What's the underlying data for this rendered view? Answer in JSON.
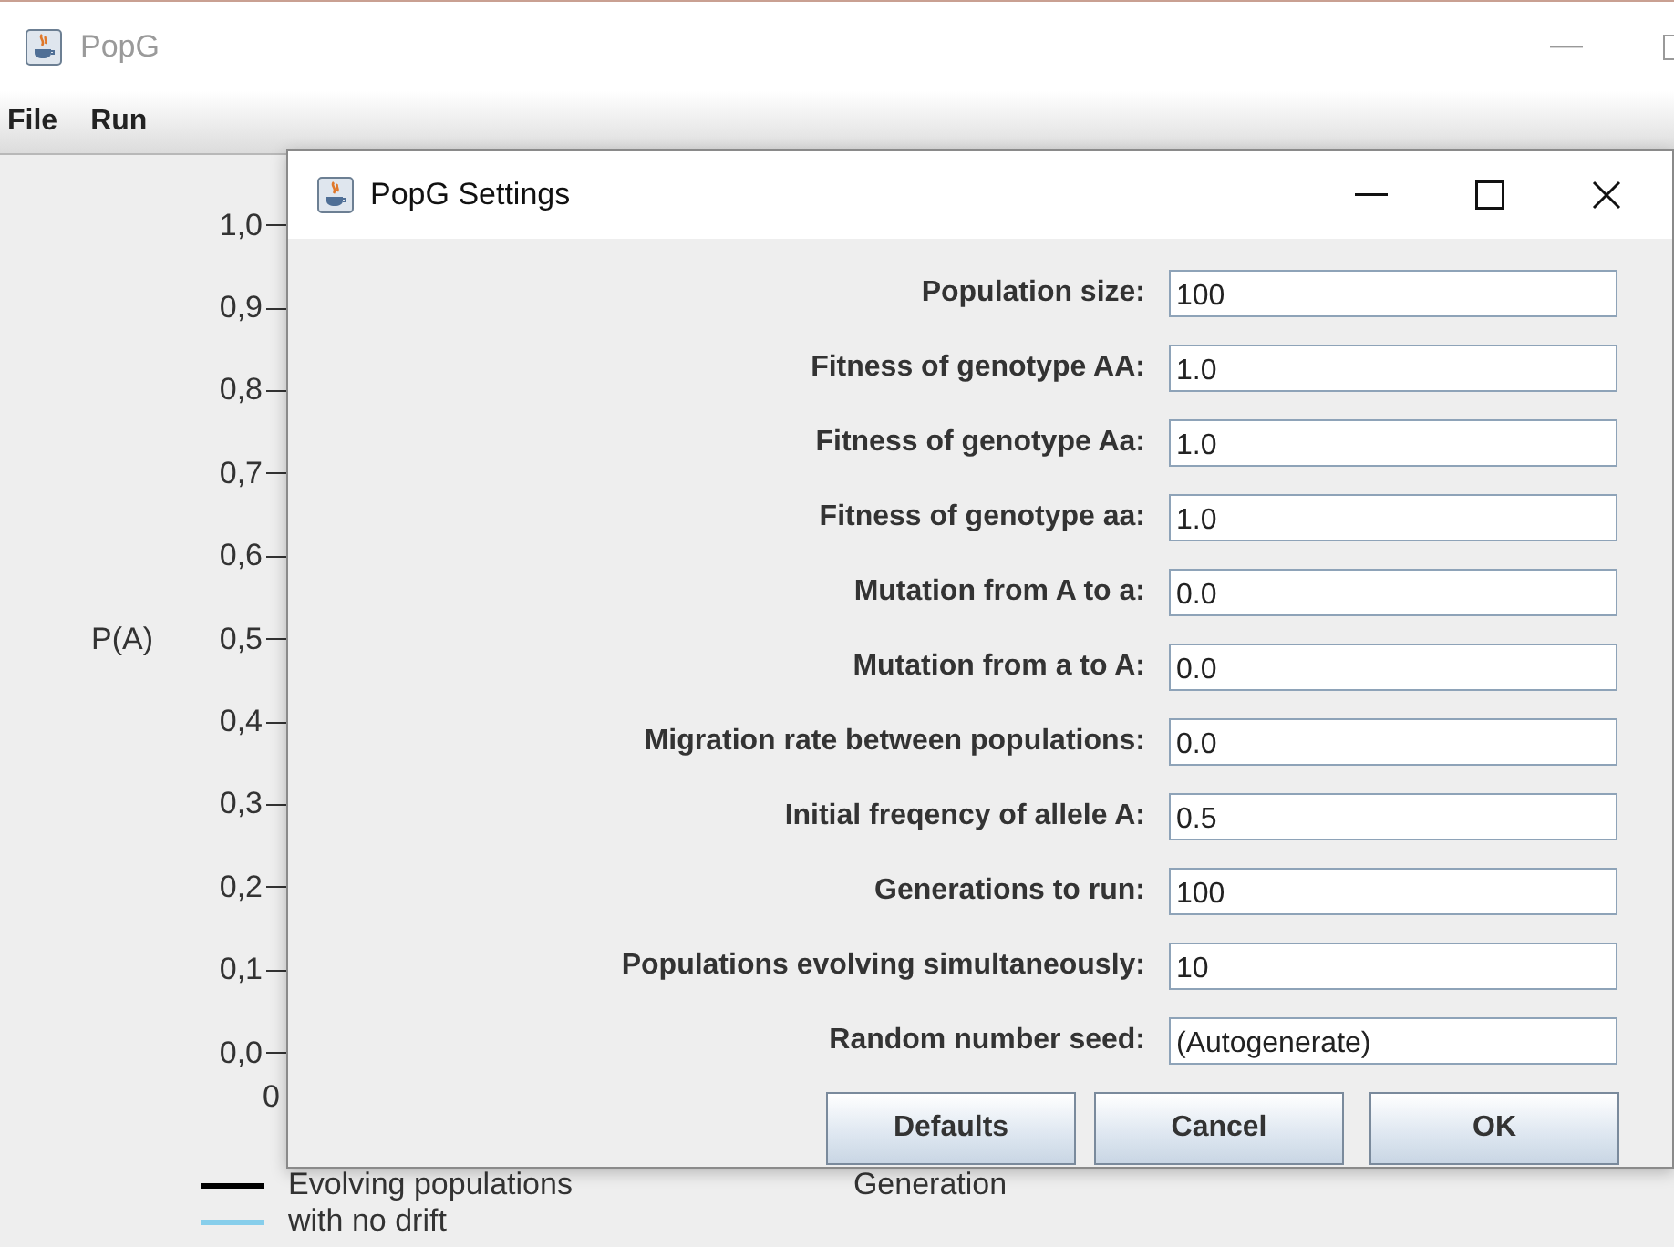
{
  "window": {
    "title": "PopG"
  },
  "menu": [
    "File",
    "Run"
  ],
  "plot": {
    "y_label": "P(A)",
    "y_ticks": [
      "1,0",
      "0,9",
      "0,8",
      "0,7",
      "0,6",
      "0,5",
      "0,4",
      "0,3",
      "0,2",
      "0,1",
      "0,0"
    ],
    "x_ticks": [
      "0"
    ],
    "x_label": "Generation",
    "legend": [
      {
        "label": "Evolving populations",
        "color": "#000000"
      },
      {
        "label": "with no drift",
        "color": "#87ceeb"
      }
    ]
  },
  "dialog": {
    "title": "PopG Settings",
    "fields": [
      {
        "label": "Population size:",
        "value": "100"
      },
      {
        "label": "Fitness of genotype AA:",
        "value": "1.0"
      },
      {
        "label": "Fitness of genotype Aa:",
        "value": "1.0"
      },
      {
        "label": "Fitness of genotype aa:",
        "value": "1.0"
      },
      {
        "label": "Mutation from A to a:",
        "value": "0.0"
      },
      {
        "label": "Mutation from a to A:",
        "value": "0.0"
      },
      {
        "label": "Migration rate between populations:",
        "value": "0.0"
      },
      {
        "label": "Initial freqency of allele A:",
        "value": "0.5"
      },
      {
        "label": "Generations to run:",
        "value": "100"
      },
      {
        "label": "Populations evolving simultaneously:",
        "value": "10"
      },
      {
        "label": "Random number seed:",
        "value": "(Autogenerate)"
      }
    ],
    "buttons": [
      "Defaults",
      "Cancel",
      "OK"
    ]
  }
}
